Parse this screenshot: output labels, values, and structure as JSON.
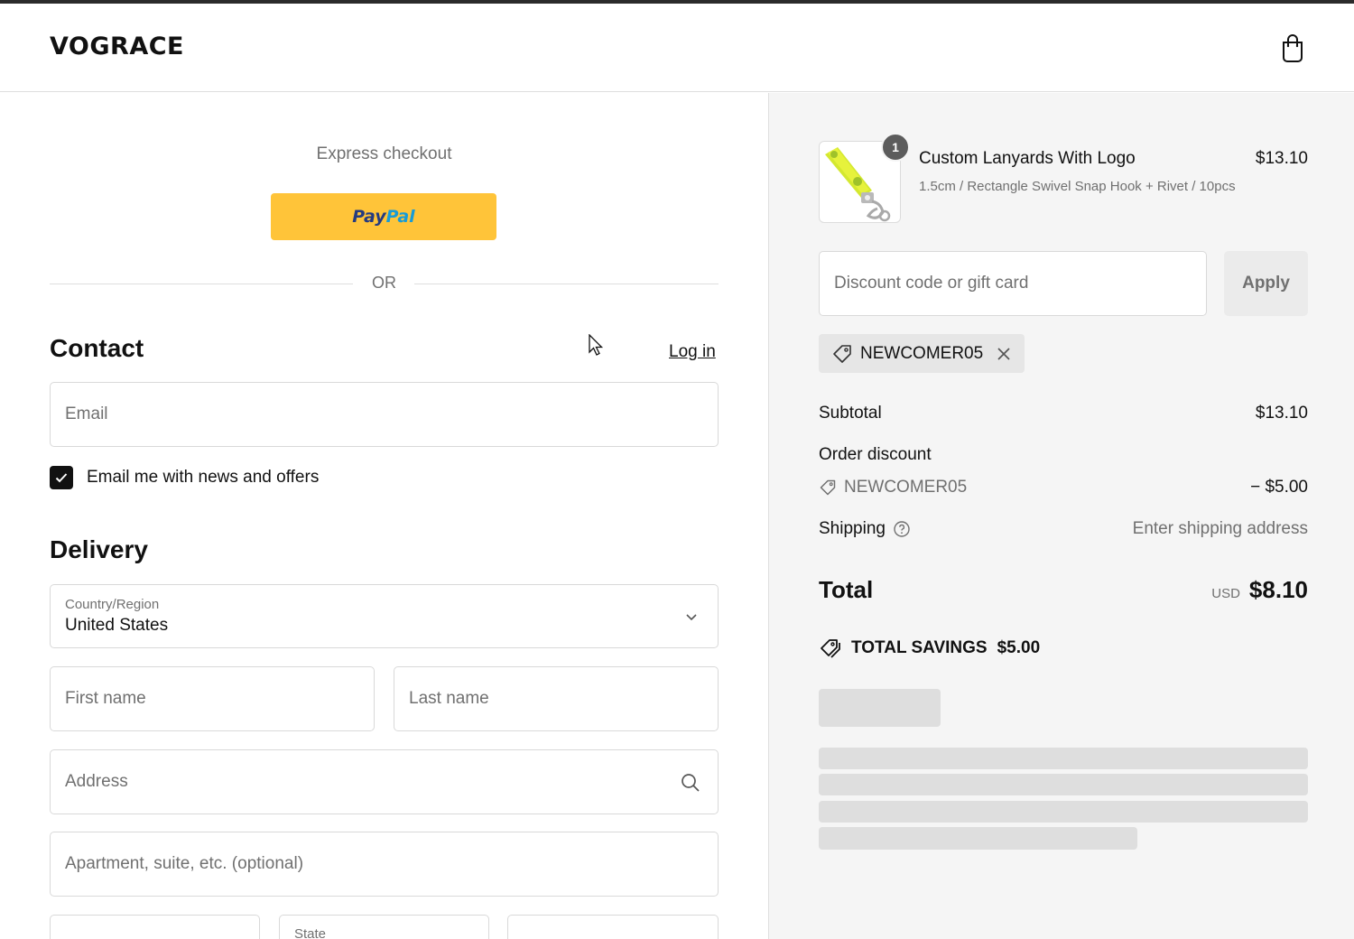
{
  "header": {
    "brand": "VOGRACE",
    "cart_icon": "shopping-bag-icon"
  },
  "express": {
    "label": "Express checkout",
    "paypal_part1": "Pay",
    "paypal_part2": "Pal",
    "or": "OR"
  },
  "contact": {
    "title": "Contact",
    "login": "Log in",
    "email_placeholder": "Email",
    "newsletter_label": "Email me with news and offers",
    "newsletter_checked": true
  },
  "delivery": {
    "title": "Delivery",
    "country_label": "Country/Region",
    "country_value": "United States",
    "first_name_placeholder": "First name",
    "last_name_placeholder": "Last name",
    "address_placeholder": "Address",
    "apartment_placeholder": "Apartment, suite, etc. (optional)",
    "state_label": "State"
  },
  "summary": {
    "product": {
      "title": "Custom Lanyards With Logo",
      "variant": "1.5cm / Rectangle Swivel Snap Hook + Rivet / 10pcs",
      "price": "$13.10",
      "quantity": "1"
    },
    "discount_placeholder": "Discount code or gift card",
    "apply_label": "Apply",
    "applied_code": "NEWCOMER05",
    "subtotal_label": "Subtotal",
    "subtotal_value": "$13.10",
    "order_discount_label": "Order discount",
    "discount_code": "NEWCOMER05",
    "discount_value": "− $5.00",
    "shipping_label": "Shipping",
    "shipping_value": "Enter shipping address",
    "total_label": "Total",
    "currency": "USD",
    "total_value": "$8.10",
    "savings_label": "TOTAL SAVINGS",
    "savings_value": "$5.00"
  },
  "colors": {
    "paypal_yellow": "#ffc439",
    "summary_bg": "#f5f5f5"
  }
}
